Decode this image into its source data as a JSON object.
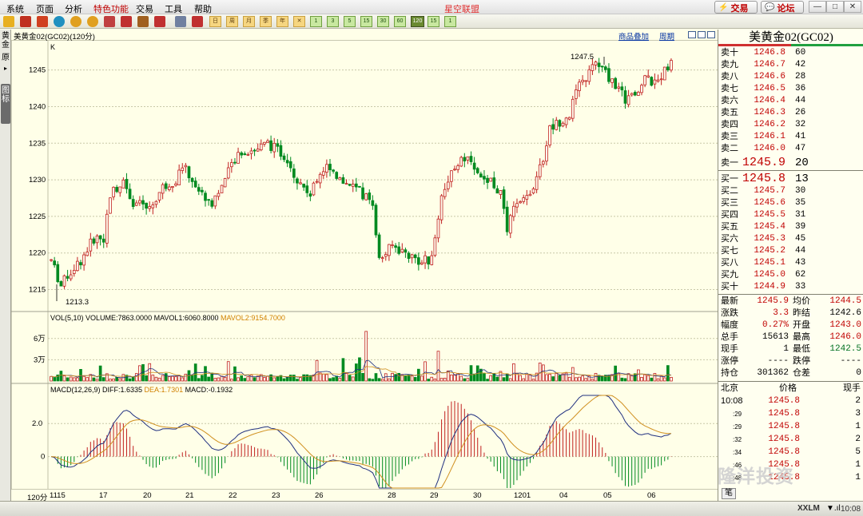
{
  "menubar": {
    "items": [
      "系统",
      "页面",
      "分析",
      "特色功能",
      "交易",
      "工具",
      "帮助"
    ],
    "app_title": "星空联盟",
    "trade_button": "交易",
    "forum_button": "论坛"
  },
  "toolbar": {
    "period_buttons": [
      "日",
      "周",
      "月",
      "季",
      "年",
      "1",
      "3",
      "5",
      "15",
      "30",
      "60",
      "120",
      "15",
      "1"
    ]
  },
  "left_tabs": {
    "tab1": "黄金",
    "tab2": "原",
    "tab3": "图标"
  },
  "chart_header": {
    "name": "美黄金02(GC02)(120分)",
    "overlay_link": "商品叠加",
    "cycle_link": "周期",
    "k_label": "K"
  },
  "indicators": {
    "vol_prefix": "VOL(5,10) VOLUME:7863.0000 MAVOL1:6060.8000 ",
    "vol_mavol2": "MAVOL2:9154.7000",
    "macd_prefix": "MACD(12,26,9) DIFF:1.6335 ",
    "macd_dea": "DEA:1.7301",
    "macd_val": " MACD:-0.1932"
  },
  "chart_data": {
    "type": "candlestick",
    "period": "120分",
    "price_axis_ticks": [
      1215,
      1220,
      1225,
      1230,
      1235,
      1240,
      1245
    ],
    "price_range": [
      1212,
      1249
    ],
    "high_annotation": "1247.5",
    "low_annotation": "1213.3",
    "volume_axis_ticks": [
      "3万",
      "6万"
    ],
    "volume_range": [
      0,
      80000
    ],
    "macd_axis_ticks": [
      "2.0",
      "0"
    ],
    "macd_range": [
      -1.9,
      3.7
    ],
    "x_labels": [
      "1115",
      "17",
      "20",
      "21",
      "22",
      "23",
      "26",
      "28",
      "29",
      "30",
      "1201",
      "04",
      "05",
      "06"
    ],
    "corner_label": "120分"
  },
  "orderbook": {
    "title": "美黄金02(GC02)",
    "asks": [
      {
        "label": "卖十",
        "price": "1246.8",
        "vol": "60"
      },
      {
        "label": "卖九",
        "price": "1246.7",
        "vol": "42"
      },
      {
        "label": "卖八",
        "price": "1246.6",
        "vol": "28"
      },
      {
        "label": "卖七",
        "price": "1246.5",
        "vol": "36"
      },
      {
        "label": "卖六",
        "price": "1246.4",
        "vol": "44"
      },
      {
        "label": "卖五",
        "price": "1246.3",
        "vol": "26"
      },
      {
        "label": "卖四",
        "price": "1246.2",
        "vol": "32"
      },
      {
        "label": "卖三",
        "price": "1246.1",
        "vol": "41"
      },
      {
        "label": "卖二",
        "price": "1246.0",
        "vol": "47"
      },
      {
        "label": "卖一",
        "price": "1245.9",
        "vol": "20"
      }
    ],
    "bids": [
      {
        "label": "买一",
        "price": "1245.8",
        "vol": "13"
      },
      {
        "label": "买二",
        "price": "1245.7",
        "vol": "30"
      },
      {
        "label": "买三",
        "price": "1245.6",
        "vol": "35"
      },
      {
        "label": "买四",
        "price": "1245.5",
        "vol": "31"
      },
      {
        "label": "买五",
        "price": "1245.4",
        "vol": "39"
      },
      {
        "label": "买六",
        "price": "1245.3",
        "vol": "45"
      },
      {
        "label": "买七",
        "price": "1245.2",
        "vol": "44"
      },
      {
        "label": "买八",
        "price": "1245.1",
        "vol": "43"
      },
      {
        "label": "买九",
        "price": "1245.0",
        "vol": "62"
      },
      {
        "label": "买十",
        "price": "1244.9",
        "vol": "33"
      }
    ]
  },
  "stats": [
    {
      "l1": "最新",
      "v1": "1245.9",
      "c1": "red",
      "l2": "均价",
      "v2": "1244.5",
      "c2": "red"
    },
    {
      "l1": "涨跌",
      "v1": "3.3",
      "c1": "red",
      "l2": "昨结",
      "v2": "1242.6",
      "c2": "blk"
    },
    {
      "l1": "幅度",
      "v1": "0.27%",
      "c1": "red",
      "l2": "开盘",
      "v2": "1243.0",
      "c2": "red"
    },
    {
      "l1": "总手",
      "v1": "15613",
      "c1": "blk",
      "l2": "最高",
      "v2": "1246.0",
      "c2": "red"
    },
    {
      "l1": "现手",
      "v1": "1",
      "c1": "blk",
      "l2": "最低",
      "v2": "1242.5",
      "c2": "grn"
    },
    {
      "l1": "涨停",
      "v1": "----",
      "c1": "blk",
      "l2": "跌停",
      "v2": "----",
      "c2": "blk"
    },
    {
      "l1": "持仓",
      "v1": "301362",
      "c1": "blk",
      "l2": "仓差",
      "v2": "0",
      "c2": "blk"
    }
  ],
  "trades": {
    "header": {
      "time": "北京",
      "price": "价格",
      "vol": "现手"
    },
    "rows": [
      {
        "time": "10:08",
        "price": "1245.8",
        "vol": "2"
      },
      {
        "time": ":29",
        "price": "1245.8",
        "vol": "3"
      },
      {
        "time": ":29",
        "price": "1245.8",
        "vol": "1"
      },
      {
        "time": ":32",
        "price": "1245.8",
        "vol": "2"
      },
      {
        "time": ":34",
        "price": "1245.8",
        "vol": "5"
      },
      {
        "time": ":46",
        "price": "1245.8",
        "vol": "1"
      },
      {
        "time": ":48",
        "price": "1245.8",
        "vol": "1"
      }
    ],
    "bottom_button": "笔"
  },
  "watermark": "隆洋投资",
  "statusbar": {
    "logo": "XXLM",
    "time": "10:08"
  }
}
